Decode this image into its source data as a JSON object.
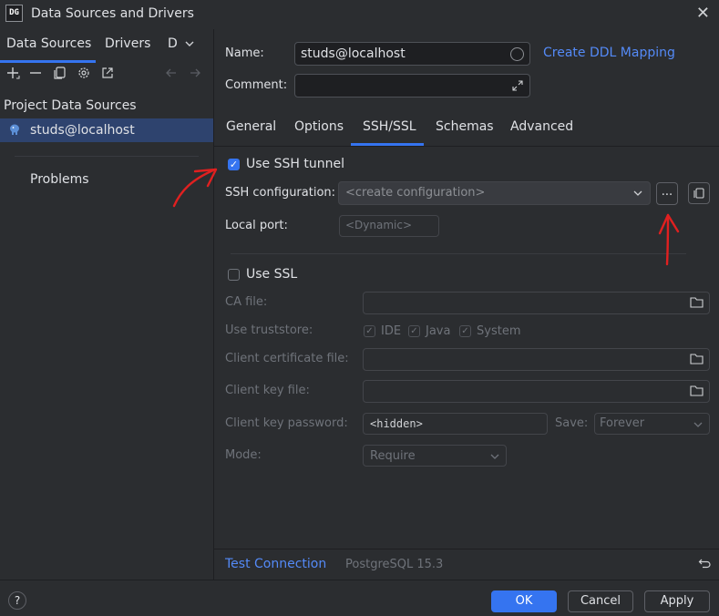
{
  "window": {
    "app_icon": "DG",
    "title": "Data Sources and Drivers",
    "close_glyph": "✕"
  },
  "sidebar": {
    "tabs": [
      {
        "label": "Data Sources"
      },
      {
        "label": "Drivers"
      },
      {
        "label": "D"
      }
    ],
    "section_title": "Project Data Sources",
    "items": [
      {
        "label": "studs@localhost",
        "icon": "postgres-elephant-icon"
      }
    ],
    "problems_label": "Problems"
  },
  "form": {
    "name_label": "Name:",
    "name_value": "studs@localhost",
    "comment_label": "Comment:",
    "comment_value": "",
    "create_ddl_link": "Create DDL Mapping"
  },
  "tabs": [
    {
      "label": "General"
    },
    {
      "label": "Options"
    },
    {
      "label": "SSH/SSL"
    },
    {
      "label": "Schemas"
    },
    {
      "label": "Advanced"
    }
  ],
  "ssh": {
    "use_ssh_label": "Use SSH tunnel",
    "use_ssh_checked": true,
    "config_label": "SSH configuration:",
    "config_value": "<create configuration>",
    "more_button": "...",
    "local_port_label": "Local port:",
    "local_port_placeholder": "<Dynamic>"
  },
  "ssl": {
    "use_ssl_label": "Use SSL",
    "use_ssl_checked": false,
    "ca_file_label": "CA file:",
    "truststore_label": "Use truststore:",
    "truststore_options": [
      {
        "label": "IDE"
      },
      {
        "label": "Java"
      },
      {
        "label": "System"
      }
    ],
    "client_cert_label": "Client certificate file:",
    "client_key_label": "Client key file:",
    "client_key_password_label": "Client key password:",
    "client_key_password_value": "<hidden>",
    "save_label": "Save:",
    "save_value": "Forever",
    "mode_label": "Mode:",
    "mode_value": "Require"
  },
  "bottom": {
    "test_connection": "Test Connection",
    "driver_info": "PostgreSQL 15.3",
    "help": "?",
    "ok": "OK",
    "cancel": "Cancel",
    "apply": "Apply"
  },
  "colors": {
    "accent": "#3574f0",
    "link": "#548af7",
    "annotation": "#e02020",
    "background": "#2b2d30"
  }
}
